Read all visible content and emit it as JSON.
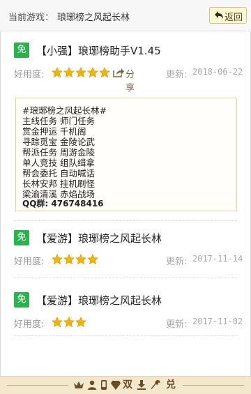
{
  "header": {
    "prefix": "当前游戏：",
    "game_name": "琅琊榜之风起长林",
    "back_label": "返回"
  },
  "rating_label": "好用度:",
  "update_label": "更新:",
  "share_label": "分享",
  "free_badge": "免",
  "items": [
    {
      "title": "【小强】琅琊榜助手V1.45",
      "stars": 5,
      "date": "2018-06-22",
      "description": [
        "#琅琊榜之风起长林#",
        "主线任务  师门任务",
        "赏金押运  千机阁",
        "寻踪觅宝  金陵论武",
        "帮派任务  周游金陵",
        "单人竞技  组队缉拿",
        "帮会委托  自动喊话",
        "长林安邦  挂机刷怪",
        "梁渝清溪  赤焰战场",
        "QQ群: 476748416"
      ]
    },
    {
      "title": "【爱游】琅琊榜之风起长林",
      "stars": 4,
      "date": "2017-11-14"
    },
    {
      "title": "【爱游】琅琊榜之风起长林",
      "stars": 3,
      "date": "2017-11-02"
    }
  ],
  "bottom_bar": {
    "icons": [
      "crown-icon",
      "user-icon",
      "phone-icon",
      "diamond-icon",
      "double-icon",
      "download-icon",
      "wrench-icon",
      "exchange-icon"
    ],
    "double_glyph": "双",
    "exchange_glyph": "兑"
  },
  "colors": {
    "star": "#f2b400",
    "free_badge": "#2bb24c",
    "bottom_bar": "#f4e8cc"
  }
}
